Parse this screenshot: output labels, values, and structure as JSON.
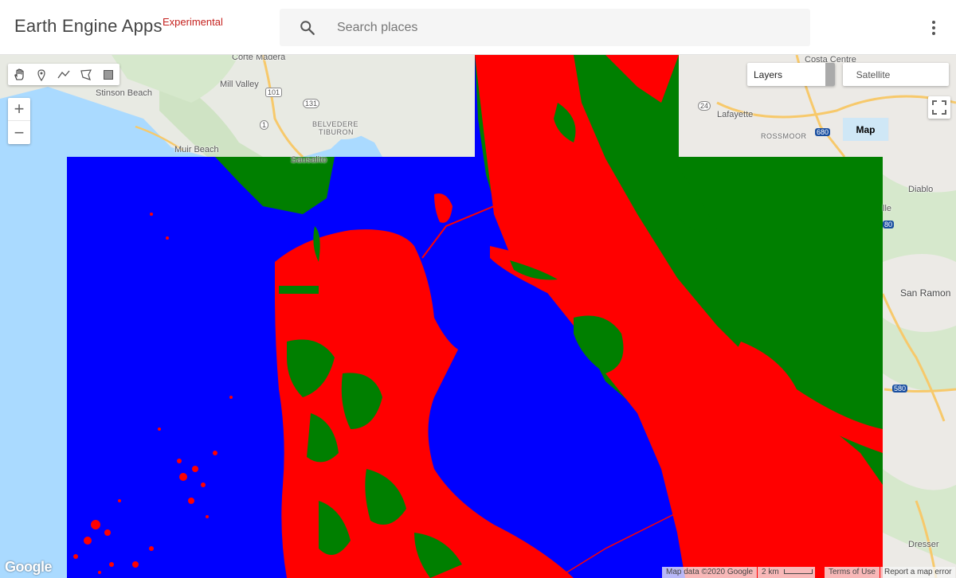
{
  "header": {
    "app_title": "Earth Engine Apps",
    "badge": "Experimental",
    "search_placeholder": "Search places"
  },
  "map": {
    "draw_tools": [
      "pan-hand-icon",
      "marker-icon",
      "line-icon",
      "polygon-icon",
      "rectangle-icon"
    ],
    "zoom_in": "+",
    "zoom_out": "−",
    "layers_label": "Layers",
    "map_type": {
      "map": "Map",
      "satellite": "Satellite",
      "selected": "Map"
    },
    "places": {
      "corte_madera": "Corte Madera",
      "mill_valley": "Mill Valley",
      "stinson_beach": "Stinson Beach",
      "belvedere": "BELVEDERE",
      "tiburon": "TIBURON",
      "muir_beach": "Muir Beach",
      "sausalito": "Sausalito",
      "costa_centre": "Costa Centre",
      "lafayette": "Lafayette",
      "rossmoor": "ROSSMOOR",
      "diablo": "Diablo",
      "ville": "lle",
      "san_ramon": "San Ramon",
      "dresser": "Dresser"
    },
    "route_shields": [
      "101",
      "131",
      "1",
      "24",
      "680",
      "580",
      "80",
      "580"
    ],
    "classification_colors": {
      "water": "#0000ff",
      "urban": "#ff0000",
      "vegetation": "#007f00"
    }
  },
  "footer": {
    "logo": "Google",
    "map_data": "Map data ©2020 Google",
    "scale": "2 km",
    "terms": "Terms of Use",
    "report": "Report a map error"
  }
}
